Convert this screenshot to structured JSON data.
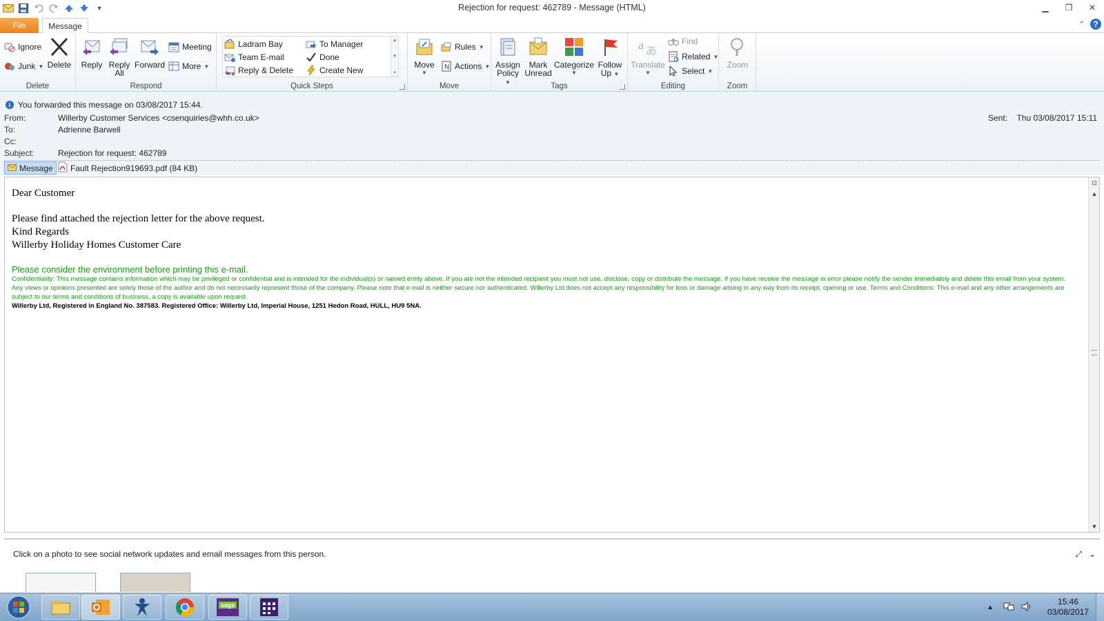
{
  "window": {
    "title": "Rejection for request: 462789  -  Message (HTML)"
  },
  "tabs": {
    "file": "File",
    "message": "Message"
  },
  "ribbon": {
    "delete": {
      "label": "Delete",
      "ignore": "Ignore",
      "junk": "Junk",
      "delete_btn": "Delete"
    },
    "respond": {
      "label": "Respond",
      "reply": "Reply",
      "reply_all_1": "Reply",
      "reply_all_2": "All",
      "forward": "Forward",
      "meeting": "Meeting",
      "more": "More"
    },
    "quick_steps": {
      "label": "Quick Steps",
      "items": [
        "Ladram Bay",
        "Team E-mail",
        "Reply & Delete",
        "To Manager",
        "Done",
        "Create New"
      ]
    },
    "move": {
      "label": "Move",
      "move_btn": "Move",
      "rules": "Rules",
      "actions": "Actions"
    },
    "tags": {
      "label": "Tags",
      "assign_1": "Assign",
      "assign_2": "Policy",
      "mark_1": "Mark",
      "mark_2": "Unread",
      "categorize": "Categorize",
      "follow_1": "Follow",
      "follow_2": "Up"
    },
    "editing": {
      "label": "Editing",
      "translate": "Translate",
      "find": "Find",
      "related": "Related",
      "select": "Select"
    },
    "zoom": {
      "label": "Zoom",
      "zoom_btn": "Zoom"
    }
  },
  "header": {
    "info": "You forwarded this message on 03/08/2017 15:44.",
    "from_label": "From:",
    "from_value": "Willerby Customer Services <csenquiries@whh.co.uk>",
    "to_label": "To:",
    "to_value": "Adrienne Barwell",
    "cc_label": "Cc:",
    "cc_value": "",
    "subject_label": "Subject:",
    "subject_value": "Rejection for request: 462789",
    "sent_label": "Sent:",
    "sent_value": "Thu 03/08/2017 15:11",
    "attachments": {
      "message": "Message",
      "pdf": "Fault Rejection919693.pdf (84 KB)"
    }
  },
  "body": {
    "greeting": "Dear Customer",
    "line1": "Please find attached the rejection letter for the above request.",
    "line2": "Kind Regards",
    "line3": "Willerby Holiday Homes Customer Care",
    "env": "Please consider the environment before printing this e-mail.",
    "confidentiality": "Confidentiality: This message contains information which may be privileged or confidential and is intended for the individual(s) or named entity above. If you are not the intended recipient you must not use, disclose, copy or distribute the message. If you have receive the message in error please notify the sender immediately and delete this email from your system. Any views or opinions presented are solely those of the author and do not necessarily represent those of the company. Please note that e-mail is neither secure nor authenticated. Willerby Ltd does not accept any responsibility for loss or damage arising in any way from its receipt, opening or use. Terms and Conditions: This e-mail and any other arrangements are subject to our terms and conditions of business, a copy is available upon request.",
    "registered": "Willerby Ltd, Registered in England No. 387583. Registered Office: Willerby Ltd, Imperial House, 1251 Hedon Road, HULL, HU9 5NA."
  },
  "people_pane": {
    "text": "Click on a photo to see social network updates and email messages from this person."
  },
  "taskbar": {
    "time": "15:46",
    "date": "03/08/2017",
    "apps": [
      "windows-explorer-icon",
      "outlook-icon",
      "app-figure-icon",
      "chrome-icon",
      "sage-icon",
      "calendar-app-icon"
    ]
  },
  "colors": {
    "file_tab": "#e9831d",
    "green_text": "#1a9b1a",
    "accent_blue": "#2b6fc4"
  }
}
